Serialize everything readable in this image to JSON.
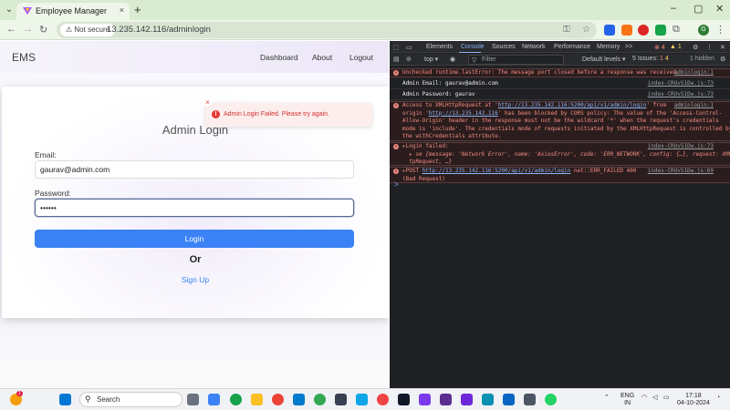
{
  "browser": {
    "tab_title": "Employee Manager",
    "tab_close": "×",
    "new_tab": "+",
    "security_label": "Not secure",
    "url": "13.235.142.116/adminlogin",
    "window_minimize": "–",
    "window_maximize": "▢",
    "window_close": "✕",
    "profile_initial": "G"
  },
  "site": {
    "brand": "EMS",
    "nav": [
      "Dashboard",
      "About",
      "Logout"
    ]
  },
  "login": {
    "title": "Admin Login",
    "email_label": "Email:",
    "email_value": "gaurav@admin.com",
    "password_label": "Password:",
    "password_value": "••••••",
    "login_button": "Login",
    "or_text": "Or",
    "signup_link": "Sign Up"
  },
  "toast": {
    "message": "Admin Login Failed. Please try again.",
    "close": "×",
    "icon": "!"
  },
  "devtools": {
    "tabs": [
      "Elements",
      "Console",
      "Sources",
      "Network",
      "Performance",
      "Memory",
      ">>"
    ],
    "active_tab": "Console",
    "error_count": "4",
    "warning_count": "1",
    "context": "top ▾",
    "filter_placeholder": "Filter",
    "levels": "Default levels ▾",
    "issues": "5 Issues:",
    "issues_err": "1",
    "issues_warn": "4",
    "hidden": "1 hidden",
    "messages": [
      {
        "type": "err",
        "text": "Unchecked runtime.lastError: The message port closed before a response was received.",
        "src": "adminlogin:1"
      },
      {
        "type": "log",
        "text": "Admin Email: gaurav@admin.com",
        "src": "index-CRUv51Dw.js:73"
      },
      {
        "type": "log",
        "text": "Admin Password: gaurav",
        "src": "index-CRUv51Dw.js:73"
      },
      {
        "type": "err",
        "line1_pre": "Access to XMLHttpRequest at '",
        "line1_link": "http://13.235.142.116:5200/api/v1/admin/login",
        "line1_post": "' from",
        "src": "adminlogin:1",
        "line2_pre": "origin '",
        "line2_link": "http://13.235.142.116",
        "line2_post": "' has been blocked by CORS policy: The value of the 'Access-Control-",
        "line3": "Allow-Origin' header in the response must not be the wildcard '*' when the request's credentials",
        "line4": "mode is 'include'. The credentials mode of requests initiated by the XMLHttpRequest is controlled by",
        "line5": "the withCredentials attribute."
      },
      {
        "type": "err",
        "line1": "▸Login failed:",
        "src": "index-CRUv51Dw.js:73",
        "line2": "  ▸ se {message: 'Network Error', name: 'AxiosError', code: 'ERR_NETWORK', config: {…}, request: XMLHt",
        "line3": "  tpRequest, …}"
      },
      {
        "type": "err",
        "line1_pre": "▸POST ",
        "line1_link": "http://13.235.142.116:5200/api/v1/admin/login",
        "line1_post": " net::ERR_FAILED 400",
        "src": "index-CRUv51Dw.js:69",
        "line2": "(Bad Request)"
      }
    ],
    "prompt": ">"
  },
  "taskbar": {
    "search_label": "Search",
    "weather_badge": "1",
    "language_line1": "ENG",
    "language_line2": "IN",
    "time": "17:18",
    "date": "04-10-2024"
  }
}
